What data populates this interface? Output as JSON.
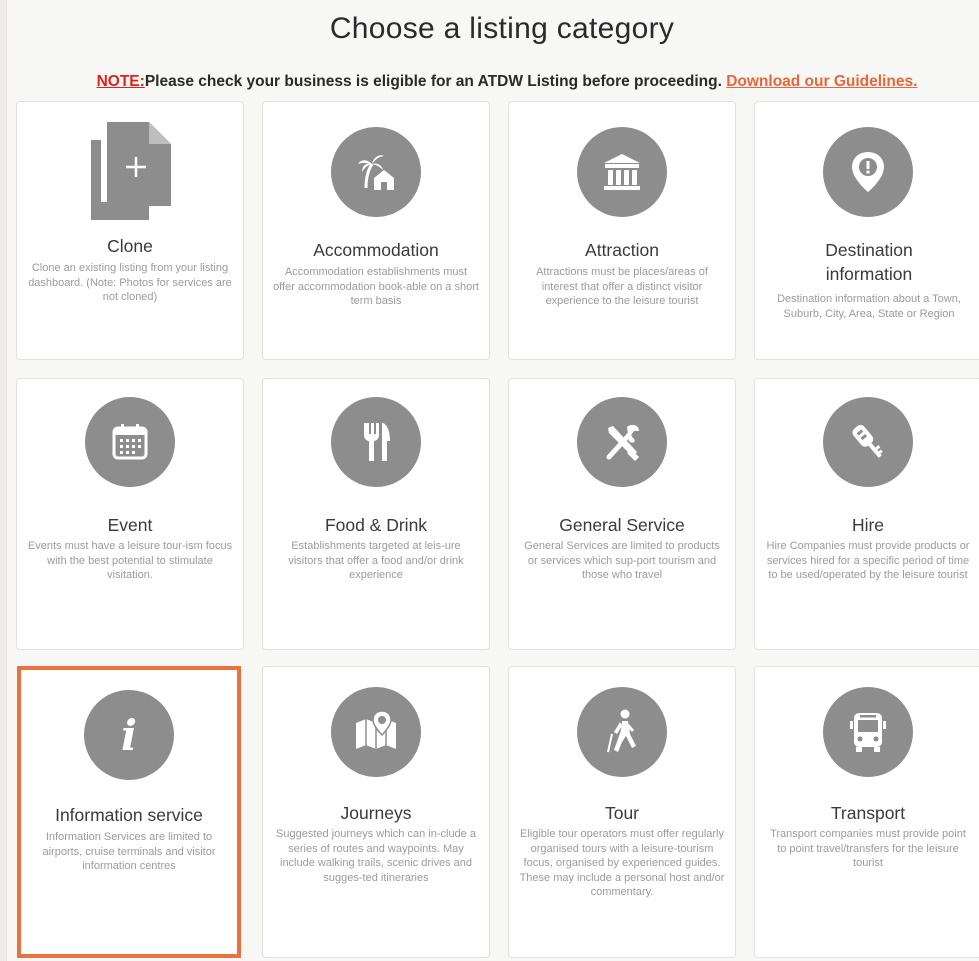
{
  "page": {
    "title": "Choose a listing category",
    "note_label": "NOTE:",
    "note_text": "Please check your business is eligible for an ATDW Listing before proceeding. ",
    "note_link": "Download our Guidelines."
  },
  "colors": {
    "accent": "#e8733f",
    "note_red": "#e0201d",
    "icon_gray": "#8d8d8d",
    "card_bg": "#ffffff"
  },
  "categories": [
    {
      "title": "Clone",
      "icon": "clone-icon",
      "desc": "Clone an existing listing from your listing dashboard. (Note: Photos for services are not cloned)"
    },
    {
      "title": "Accommodation",
      "icon": "palm-house-icon",
      "desc": "Accommodation establishments must offer accommodation book-able on a short term basis"
    },
    {
      "title": "Attraction",
      "icon": "museum-icon",
      "desc": "Attractions must be places/areas of interest that offer a distinct visitor experience to the leisure tourist"
    },
    {
      "title": "Destination information",
      "icon": "map-pin-alert-icon",
      "desc": "Destination information about a Town, Suburb, City, Area, State or Region"
    },
    {
      "title": "Event",
      "icon": "calendar-icon",
      "desc": "Events must have a leisure tour-ism focus with the best potential to stimulate visitation."
    },
    {
      "title": "Food & Drink",
      "icon": "fork-knife-icon",
      "desc": "Establishments targeted at leis-ure visitors that offer a food and/or drink experience"
    },
    {
      "title": "General Service",
      "icon": "tools-icon",
      "desc": "General Services are limited to products or services which sup-port tourism and those who travel"
    },
    {
      "title": "Hire",
      "icon": "car-key-icon",
      "desc": "Hire Companies must provide products or services hired for a specific period of time to be used/operated by the leisure tourist"
    },
    {
      "title": "Information service",
      "icon": "info-icon",
      "desc": "Information Services are limited to airports, cruise terminals and visitor information centres"
    },
    {
      "title": "Journeys",
      "icon": "map-icon",
      "desc": "Suggested journeys which can in-clude a series of routes and waypoints. May include walking trails, scenic drives and sugges-ted itineraries"
    },
    {
      "title": "Tour",
      "icon": "walking-tourist-icon",
      "desc": "Eligible tour operators must offer regularly organised tours with a leisure-tourism focus, organised by experienced guides. These may include a personal host and/or commentary."
    },
    {
      "title": "Transport",
      "icon": "bus-icon",
      "desc": "Transport companies must provide point to point travel/transfers for the leisure tourist"
    }
  ]
}
